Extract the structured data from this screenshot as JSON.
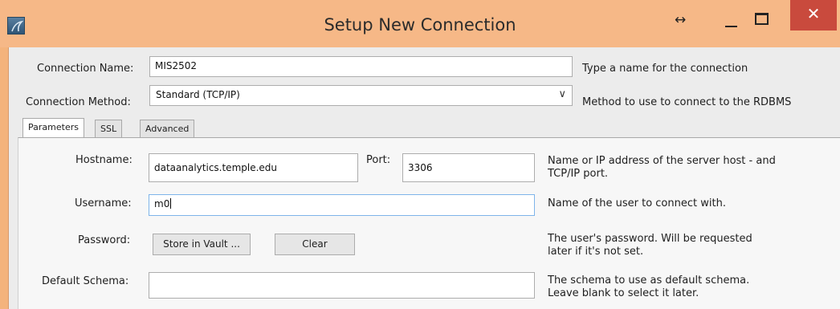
{
  "window": {
    "title": "Setup New Connection",
    "icon": "mysql-workbench-icon",
    "controls": {
      "resize": "↔",
      "close": "✕"
    }
  },
  "form": {
    "connection_name_label": "Connection Name:",
    "connection_name_value": "MIS2502",
    "connection_name_hint": "Type a name for the connection",
    "connection_method_label": "Connection Method:",
    "connection_method_value": "Standard (TCP/IP)",
    "connection_method_hint": "Method to use to connect to the RDBMS"
  },
  "tabs": [
    {
      "label": "Parameters",
      "active": true
    },
    {
      "label": "SSL",
      "active": false
    },
    {
      "label": "Advanced",
      "active": false
    }
  ],
  "parameters": {
    "hostname_label": "Hostname:",
    "hostname_value": "dataanalytics.temple.edu",
    "port_label": "Port:",
    "port_value": "3306",
    "hostname_hint_line1": "Name or IP address of the server host - and",
    "hostname_hint_line2": "TCP/IP port.",
    "username_label": "Username:",
    "username_value": "m0",
    "username_hint": "Name of the user to connect with.",
    "password_label": "Password:",
    "store_in_vault_label": "Store in Vault ...",
    "clear_label": "Clear",
    "password_hint_line1": "The user's password. Will be requested",
    "password_hint_line2": "later if it's not set.",
    "default_schema_label": "Default Schema:",
    "default_schema_value": "",
    "default_schema_hint_line1": "The schema to use as default schema.",
    "default_schema_hint_line2": "Leave blank to select it later."
  },
  "colors": {
    "titlebar": "#f6b887",
    "close_button": "#c94a3d",
    "focus_border": "#7eb4ea"
  }
}
